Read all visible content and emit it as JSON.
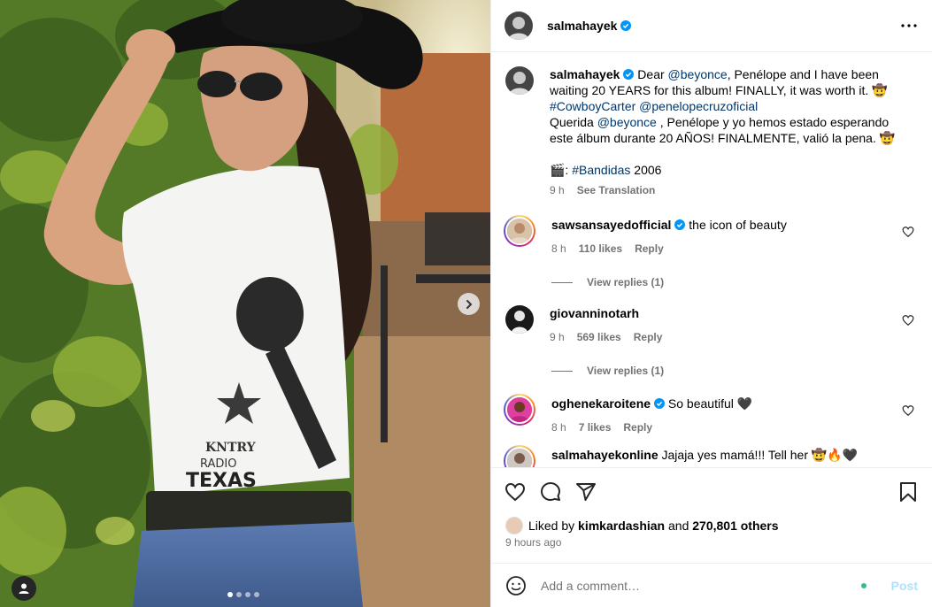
{
  "post": {
    "author": "salmahayek",
    "caption_en_prefix": "Dear ",
    "mention_beyonce": "@beyonce",
    "caption_en_mid": ", Penélope and I have been waiting 20 YEARS for this album! FINALLY, it was worth it. 🤠",
    "hashtag_cowboy": "#CowboyCarter",
    "mention_penelope": "@penelopecruzoficial",
    "caption_es_prefix": "Querida ",
    "caption_es_mid": " , Penélope y yo hemos estado esperando este álbum durante 20 AÑOS! FINALMENTE, valió la pena. 🤠",
    "caption_line3_prefix": "🎬: ",
    "hashtag_bandidas": "#Bandidas",
    "caption_line3_suffix": " 2006",
    "time": "9 h",
    "see_translation": "See Translation",
    "liked_by_prefix": "Liked by ",
    "liked_by_user": "kimkardashian",
    "liked_by_and": " and ",
    "liked_by_others": "270,801 others",
    "posted_ago": "9 hours ago",
    "comment_placeholder": "Add a comment…",
    "post_button": "Post",
    "carousel": {
      "slides": 4,
      "active": 0
    }
  },
  "comments": [
    {
      "user": "sawsansayedofficial",
      "verified": true,
      "text": "the icon of beauty",
      "time": "8 h",
      "likes": "110 likes",
      "reply": "Reply",
      "view_replies": "View replies (1)"
    },
    {
      "user": "giovanninotarh",
      "verified": false,
      "text": "",
      "time": "9 h",
      "likes": "569 likes",
      "reply": "Reply",
      "view_replies": "View replies (1)"
    },
    {
      "user": "oghenekaroitene",
      "verified": true,
      "text": "So beautiful 🖤",
      "time": "8 h",
      "likes": "7 likes",
      "reply": "Reply"
    },
    {
      "user": "salmahayekonline",
      "verified": false,
      "text": "Jajaja yes mamá!!! Tell her 🤠🔥🖤"
    }
  ],
  "colors": {
    "verified": "#0095f6",
    "link": "#00376b",
    "muted": "#737373",
    "post_disabled": "#b2dffc"
  }
}
